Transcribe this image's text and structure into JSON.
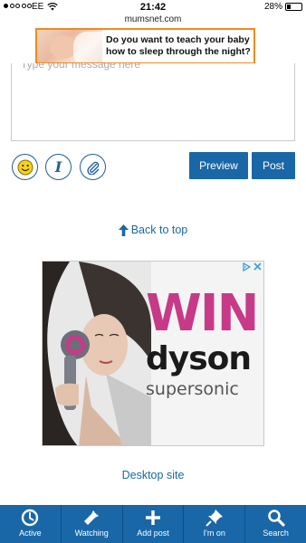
{
  "status_bar": {
    "carrier": "EE",
    "time": "21:42",
    "battery": "28%",
    "battery_level": 0.28
  },
  "browser": {
    "url": "mumsnet.com"
  },
  "top_ad": {
    "text": "Do you want to teach your baby how to sleep through the night?"
  },
  "composer": {
    "placeholder": "Type your message here",
    "preview_label": "Preview",
    "post_label": "Post"
  },
  "back_to_top": "Back to top",
  "dyson_ad": {
    "headline": "WIN",
    "brand": "dyson",
    "product": "supersonic"
  },
  "desktop_site": "Desktop site",
  "bottom_nav": {
    "items": [
      {
        "label": "Active",
        "icon": "clock-icon"
      },
      {
        "label": "Watching",
        "icon": "flashlight-icon"
      },
      {
        "label": "Add post",
        "icon": "plus-icon"
      },
      {
        "label": "I'm on",
        "icon": "pin-icon"
      },
      {
        "label": "Search",
        "icon": "search-icon"
      }
    ]
  },
  "colors": {
    "brand_blue": "#1967a7",
    "ad_border_orange": "#f08a1d",
    "win_pink": "#c73a88"
  }
}
